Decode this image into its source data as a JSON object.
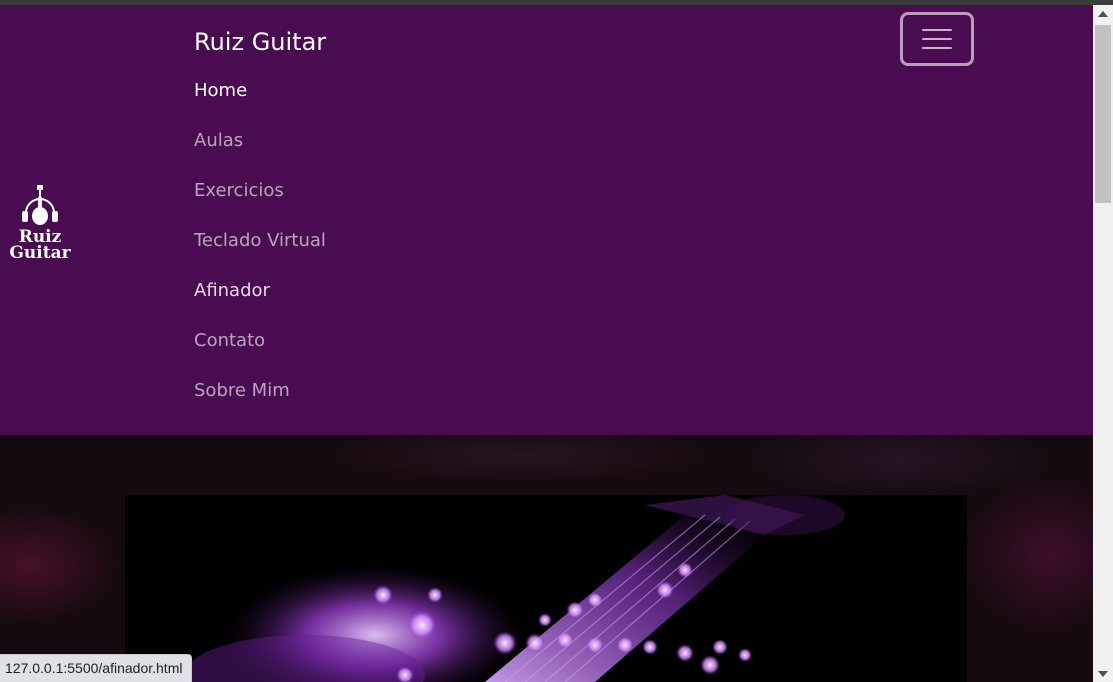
{
  "navbar": {
    "brand": "Ruiz Guitar",
    "logo_text_line1": "Ruiz",
    "logo_text_line2": "Guitar",
    "logo_icon": "guitar-headphones-logo",
    "toggler_icon": "hamburger-menu-icon",
    "items": [
      {
        "label": "Home"
      },
      {
        "label": "Aulas"
      },
      {
        "label": "Exercicios"
      },
      {
        "label": "Teclado Virtual"
      },
      {
        "label": "Afinador"
      },
      {
        "label": "Contato"
      },
      {
        "label": "Sobre Mim"
      }
    ]
  },
  "hero": {
    "image": "purple-guitar-fretboard-bokeh"
  },
  "status_bar": {
    "url": "127.0.0.1:5500/afinador.html"
  },
  "colors": {
    "navbar_bg": "#4a0c50",
    "link_active": "#ffffff",
    "link_muted": "#c7a7c9",
    "accent_purple": "#b455e8"
  }
}
